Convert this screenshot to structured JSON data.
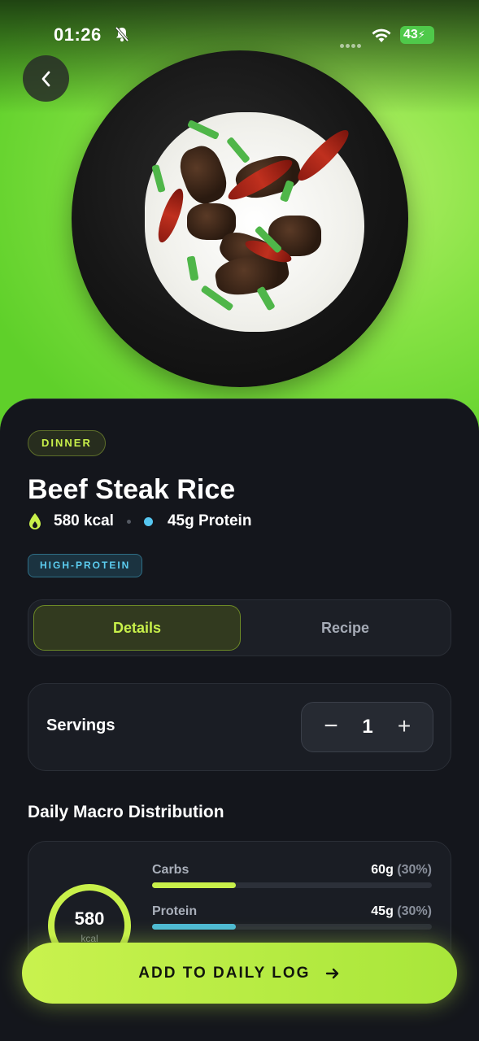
{
  "status_bar": {
    "time": "01:26",
    "battery": "43",
    "icons": [
      "bell-slash-icon",
      "cellular-dots-icon",
      "wifi-icon",
      "battery-charging-icon"
    ]
  },
  "hero": {
    "image_semantic": "beef-steak-rice-photo",
    "back_icon": "chevron-left-icon"
  },
  "meal": {
    "category": "DINNER",
    "title": "Beef Steak Rice",
    "calories": "580 kcal",
    "protein": "45g Protein",
    "tag": "HIGH-PROTEIN"
  },
  "tabs": [
    {
      "label": "Details",
      "active": true
    },
    {
      "label": "Recipe",
      "active": false
    }
  ],
  "servings": {
    "label": "Servings",
    "value": "1",
    "minus": "−",
    "plus": "+"
  },
  "macros": {
    "section_title": "Daily Macro Distribution",
    "ring_value": "580",
    "ring_unit": "kcal",
    "rows": [
      {
        "name": "Carbs",
        "amount": "60g",
        "percent": "(30%)",
        "fill": 0.3,
        "color": "#c8f04a"
      },
      {
        "name": "Protein",
        "amount": "45g",
        "percent": "(30%)",
        "fill": 0.3,
        "color": "#4bb9d6"
      }
    ]
  },
  "cta": {
    "label": "ADD TO DAILY LOG",
    "icon": "arrow-right-icon"
  },
  "colors": {
    "accent": "#c8f04a",
    "protein": "#56c6f0",
    "background": "#14161c"
  }
}
